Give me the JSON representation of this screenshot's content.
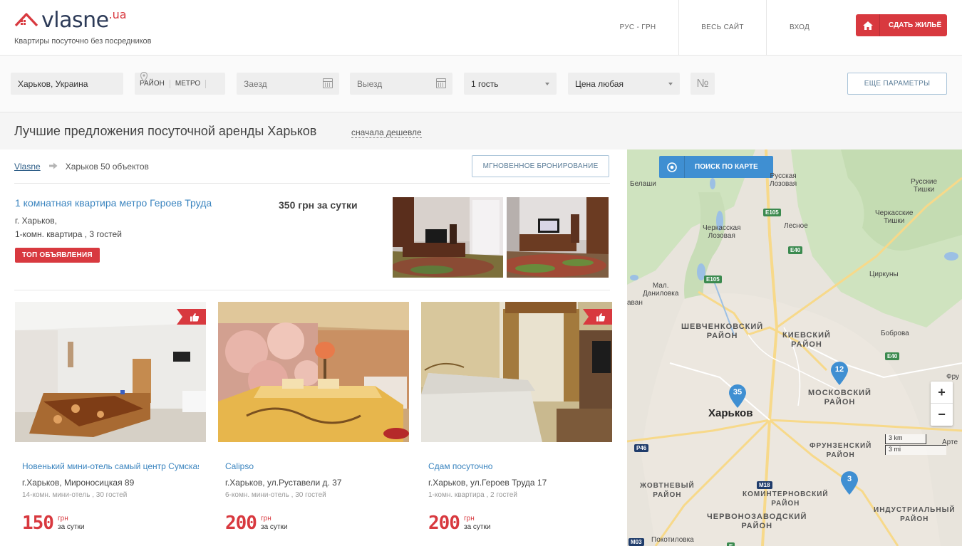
{
  "header": {
    "logo_main": "vlasne",
    "logo_suffix": ".ua",
    "tagline": "Квартиры посуточно без посредников",
    "nav": {
      "lang_currency": "РУС - ГРН",
      "whole_site": "ВЕСЬ САЙТ",
      "login": "ВХОД"
    },
    "rent_out_label": "СДАТЬ ЖИЛЬЁ",
    "accent_color": "#d8393f"
  },
  "filters": {
    "city_value": "Харьков, Украина",
    "district_label": "РАЙОН",
    "metro_label": "МЕТРО",
    "checkin_placeholder": "Заезд",
    "checkout_placeholder": "Выезд",
    "guests_value": "1 гость",
    "price_value": "Цена любая",
    "number_label": "№",
    "more_params_label": "ЕЩЕ ПАРАМЕТРЫ"
  },
  "titlebar": {
    "title": "Лучшие предложения посуточной аренды Харьков",
    "sort_label": "сначала дешевле"
  },
  "breadcrumb": {
    "home": "Vlasne",
    "current": "Харьков 50 объектов"
  },
  "instant_booking_label": "МГНОВЕННОЕ БРОНИРОВАНИЕ",
  "top_listing": {
    "title": "1 комнатная квартира метро Героев Труда",
    "price": "350 грн за сутки",
    "address": "г. Харьков,",
    "details": "1-комн. квартира , 3 гостей",
    "badge": "ТОП ОБЪЯВЛЕНИЯ"
  },
  "cards": [
    {
      "title": "Новенький мини-отель самый центр Сумская",
      "address": "г.Харьков, Мироносицкая 89",
      "meta": "14-комн. мини-отель , 30 гостей",
      "price": "150",
      "currency": "грн",
      "per": "за сутки"
    },
    {
      "title": "Calipso",
      "address": "г.Харьков, ул.Руставели д. 37",
      "meta": "6-комн. мини-отель , 30 гостей",
      "price": "200",
      "currency": "грн",
      "per": "за сутки"
    },
    {
      "title": "Сдам посуточно",
      "address": "г.Харьков, ул.Героев Труда 17",
      "meta": "1-комн. квартира , 2 гостей",
      "price": "200",
      "currency": "грн",
      "per": "за сутки"
    }
  ],
  "map": {
    "search_label": "ПОИСК ПО КАРТЕ",
    "city_label": "Харьков",
    "place_labels": {
      "belashi": "Белаши",
      "russkaya_lozovaya": "Русская\nЛозовая",
      "russkie_tishki": "Русские\nТишки",
      "cherkasskie_tishki": "Черкасские\nТишки",
      "cherkasskaya_lozovaya": "Черкасская\nЛозовая",
      "lesnoe": "Лесное",
      "mal_danilovka": "Мал.\nДаниловка",
      "tsirkuny": "Циркуны",
      "bobrovka": "Боброва",
      "pokotilovka": "Покотиловка",
      "avan": "аван",
      "fru": "Фру",
      "arte": "Арте"
    },
    "districts": {
      "shevchenkovsky": "ШЕВЧЕНКОВСКИЙ\nРАЙОН",
      "kievsky": "КИЕВСКИЙ\nРАЙОН",
      "moskovsky": "МОСКОВСКИЙ\nРАЙОН",
      "frunzensky": "ФРУНЗЕНСКИЙ\nРАЙОН",
      "zhovtnevy": "ЖОВТНЕВЫЙ\nРАЙОН",
      "kominternovsky": "КОМИНТЕРНОВСКИЙ\nРАЙОН",
      "chervonozavodsky": "ЧЕРВОНОЗАВОДСКИЙ\nРАЙОН",
      "industrialny": "ИНДУСТРИАЛЬНЫЙ\nРАЙОН"
    },
    "roads": {
      "e105_top": "E105",
      "e40_top": "E40",
      "e105_mid": "E105",
      "e40_right": "E40",
      "p46": "P46",
      "m18": "M18",
      "m03": "M03",
      "e_bottom": "E"
    },
    "clusters": {
      "a": "35",
      "b": "12",
      "c": "3"
    },
    "cluster_color": "#3f8fd2",
    "zoom_in": "+",
    "zoom_out": "−",
    "scale_km": "3 km",
    "scale_mi": "3 mi"
  }
}
